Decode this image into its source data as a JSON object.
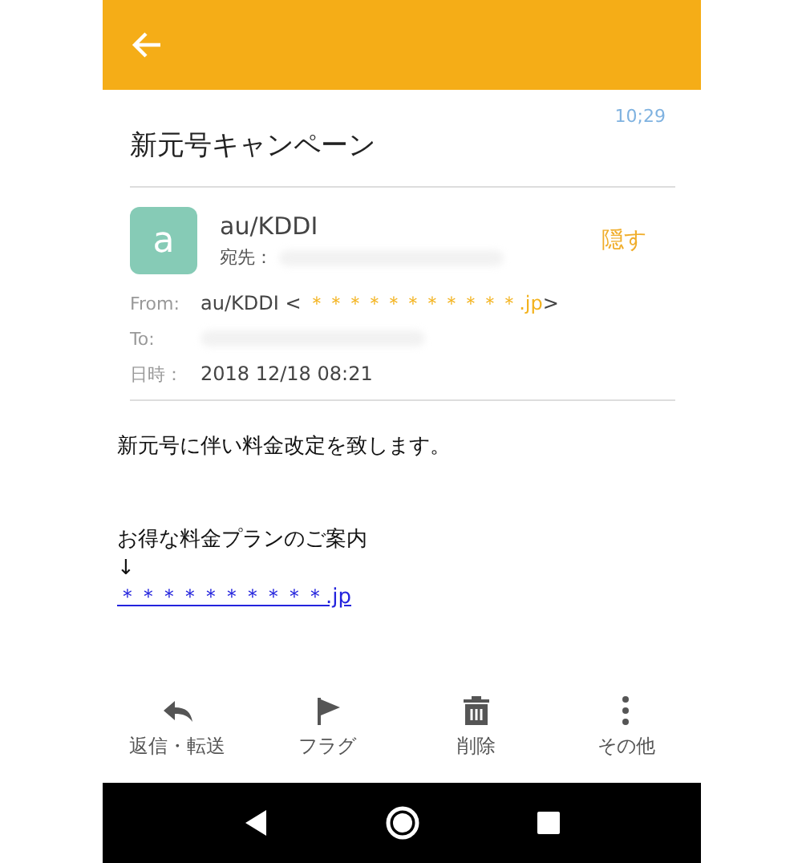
{
  "message": {
    "time": "10;29",
    "subject": "新元号キャンペーン",
    "sender": {
      "avatar": "a",
      "name": "au/KDDI",
      "to_label": "宛先：",
      "hide_button": "隠す"
    },
    "details": [
      {
        "label": "From:",
        "name": "au/KDDI < ",
        "address": "＊＊＊＊＊＊＊＊＊＊＊.jp",
        "suffix": ">"
      },
      {
        "label": "To:"
      },
      {
        "label": "日時：",
        "value": "2018 12/18 08:21"
      }
    ],
    "body": {
      "lines": [
        "新元号に伴い料金改定を致します。",
        "お得な料金プランのご案内",
        "↓"
      ],
      "link": "＊＊＊＊＊＊＊＊＊＊.jp"
    }
  },
  "actions": [
    {
      "kind": "reply",
      "label": "返信・転送"
    },
    {
      "kind": "flag",
      "label": "フラグ"
    },
    {
      "kind": "delete",
      "label": "削除"
    },
    {
      "kind": "more",
      "label": "その他"
    }
  ]
}
